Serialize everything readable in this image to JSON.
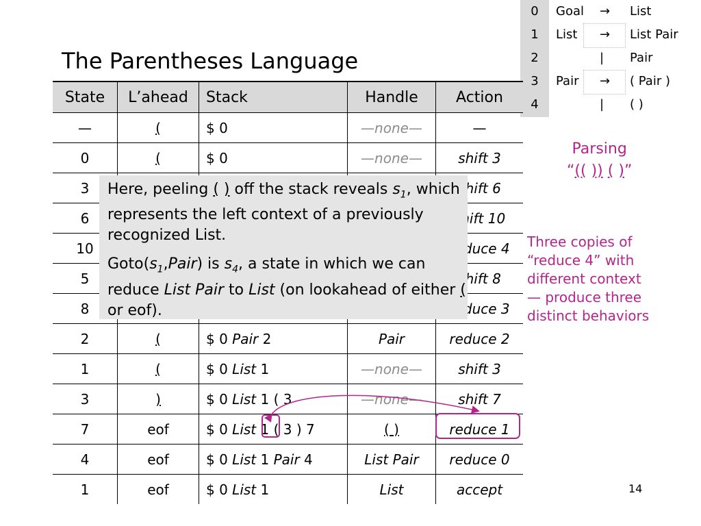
{
  "title": "The Parentheses Language",
  "grammar": [
    {
      "num": "0",
      "lhs": "Goal",
      "arrow": "→",
      "rhs": "List"
    },
    {
      "num": "1",
      "lhs": "List",
      "arrow": "→",
      "rhs": "List Pair"
    },
    {
      "num": "2",
      "lhs": "",
      "arrow": "|",
      "rhs": "Pair"
    },
    {
      "num": "3",
      "lhs": "Pair",
      "arrow": "→",
      "rhs": "( Pair )"
    },
    {
      "num": "4",
      "lhs": "",
      "arrow": "|",
      "rhs": "( )"
    }
  ],
  "table": {
    "headers": [
      "State",
      "L’ahead",
      "Stack",
      "Handle",
      "Action"
    ],
    "rows": [
      {
        "state": "—",
        "lahead": "(",
        "stack": "$ 0",
        "handle": "—none—",
        "action": "—"
      },
      {
        "state": "0",
        "lahead": "(",
        "stack": "$ 0",
        "handle": "—none—",
        "action": "shift 3"
      },
      {
        "state": "3",
        "lahead": "",
        "stack": "",
        "handle": "",
        "action": "shift 6"
      },
      {
        "state": "6",
        "lahead": "",
        "stack": "",
        "handle": "",
        "action": "shift 10"
      },
      {
        "state": "10",
        "lahead": "",
        "stack": "",
        "handle": "",
        "action": "reduce 4"
      },
      {
        "state": "5",
        "lahead": "",
        "stack": "",
        "handle": "",
        "action": "shift 8"
      },
      {
        "state": "8",
        "lahead": "",
        "stack": "",
        "handle": "",
        "action": "reduce 3"
      },
      {
        "state": "2",
        "lahead": "(",
        "stack": "$ 0 Pair 2",
        "handle": "Pair",
        "action": "reduce 2"
      },
      {
        "state": "1",
        "lahead": "(",
        "stack": "$ 0 List 1",
        "handle": "—none—",
        "action": "shift 3"
      },
      {
        "state": "3",
        "lahead": ")",
        "stack": "$ 0 List 1 ( 3",
        "handle": "—none—",
        "action": "shift 7"
      },
      {
        "state": "7",
        "lahead": "eof",
        "stack": "$ 0 List 1 ( 3 ) 7",
        "handle": "( )",
        "action": "reduce 1"
      },
      {
        "state": "4",
        "lahead": "eof",
        "stack": "$ 0 List 1 Pair 4",
        "handle": "List Pair",
        "action": "reduce 0"
      },
      {
        "state": "1",
        "lahead": "eof",
        "stack": "$ 0 List 1",
        "handle": "List",
        "action": "accept"
      }
    ]
  },
  "callout": {
    "p1": "Here, peeling ( ) off the stack reveals s1, which represents the left context of a previously recognized List.",
    "p2": "Goto(s1,Pair) is s4, a state in which we can reduce List Pair to List (on lookahead of either ( or eof)."
  },
  "side": {
    "parsing_line1": "Parsing",
    "parsing_line2": "“(( )) ( )”",
    "copies_lines": [
      "Three copies of",
      "“reduce 4” with",
      "different context",
      "— produce three",
      "distinct behaviors"
    ]
  },
  "page_number": "14",
  "colors": {
    "accent": "#b4258c",
    "header_bg": "#d9d9d9",
    "callout_bg": "#e5e5e5",
    "none_text": "#8c8c8c"
  }
}
